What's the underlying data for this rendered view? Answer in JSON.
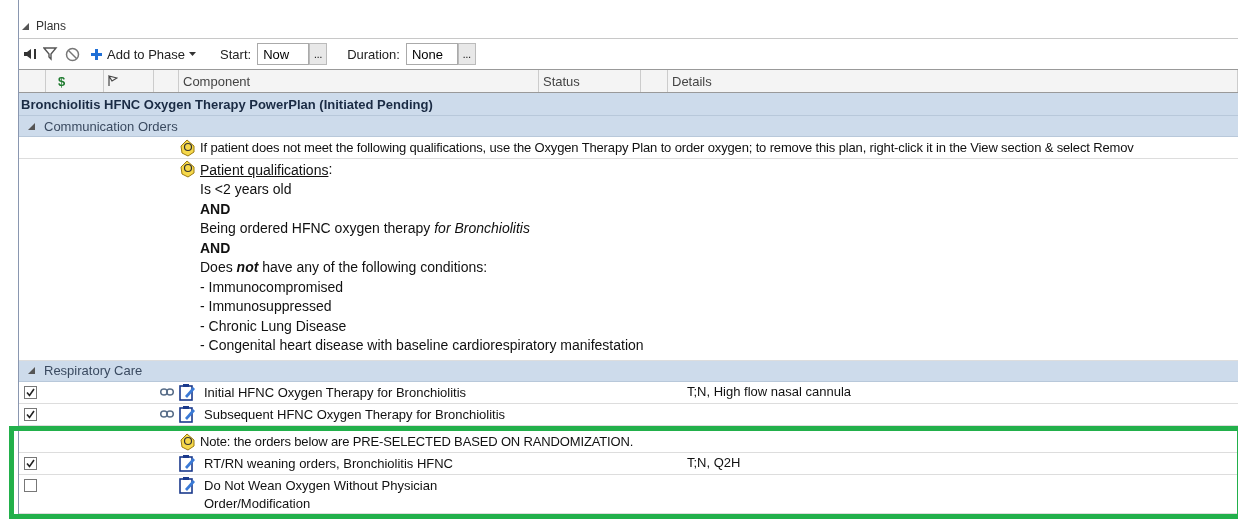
{
  "panel": {
    "title": "Plans",
    "expanded": true
  },
  "toolbar": {
    "add_button": "Add to Phase",
    "start_label": "Start:",
    "start_value": "Now",
    "start_browse": "...",
    "duration_label": "Duration:",
    "duration_value": "None",
    "duration_browse": "..."
  },
  "columns": {
    "cost": "$",
    "component": "Component",
    "status": "Status",
    "details": "Details"
  },
  "plan": {
    "title": "Bronchiolitis HFNC Oxygen Therapy PowerPlan (Initiated Pending)"
  },
  "sections": [
    {
      "title": "Communication Orders",
      "expanded": true,
      "rows": [
        {
          "kind": "note",
          "text": "If patient does not meet the following qualifications, use the Oxygen Therapy Plan to order oxygen; to remove this plan, right-click it in the View section & select Remov"
        },
        {
          "kind": "qualifications",
          "title": "Patient qualifications",
          "title_suffix": ":",
          "lines": [
            {
              "kind": "text",
              "text": "Is <2 years old"
            },
            {
              "kind": "heading",
              "text": "AND"
            },
            {
              "kind": "text",
              "text": "Being ordered HFNC oxygen therapy *for Bronchiolitis*"
            },
            {
              "kind": "heading",
              "text": "AND"
            },
            {
              "kind": "text",
              "text": "Does **not** have any of the following conditions:"
            },
            {
              "kind": "text",
              "text": "- Immunocompromised"
            },
            {
              "kind": "text",
              "text": "- Immunosuppressed"
            },
            {
              "kind": "text",
              "text": "- Chronic Lung Disease"
            },
            {
              "kind": "text",
              "text": "- Congenital heart disease with baseline cardiorespiratory manifestation"
            }
          ]
        }
      ]
    },
    {
      "title": "Respiratory Care",
      "expanded": true,
      "rows": [
        {
          "kind": "order",
          "checked": true,
          "linked": true,
          "component": "Initial HFNC Oxygen Therapy for Bronchiolitis",
          "details": "T;N, High flow nasal cannula"
        },
        {
          "kind": "order",
          "checked": true,
          "linked": true,
          "component": "Subsequent HFNC Oxygen Therapy for Bronchiolitis"
        }
      ],
      "highlighted_rows": [
        {
          "kind": "note",
          "text": "Note: the orders below are PRE-SELECTED BASED ON RANDOMIZATION."
        },
        {
          "kind": "order",
          "checked": true,
          "linked": false,
          "component": "RT/RN weaning orders, Bronchiolitis HFNC",
          "details": "T;N, Q2H"
        },
        {
          "kind": "order",
          "checked": false,
          "linked": false,
          "component": "Do Not Wean Oxygen Without Physician Order/Modification"
        }
      ]
    }
  ]
}
